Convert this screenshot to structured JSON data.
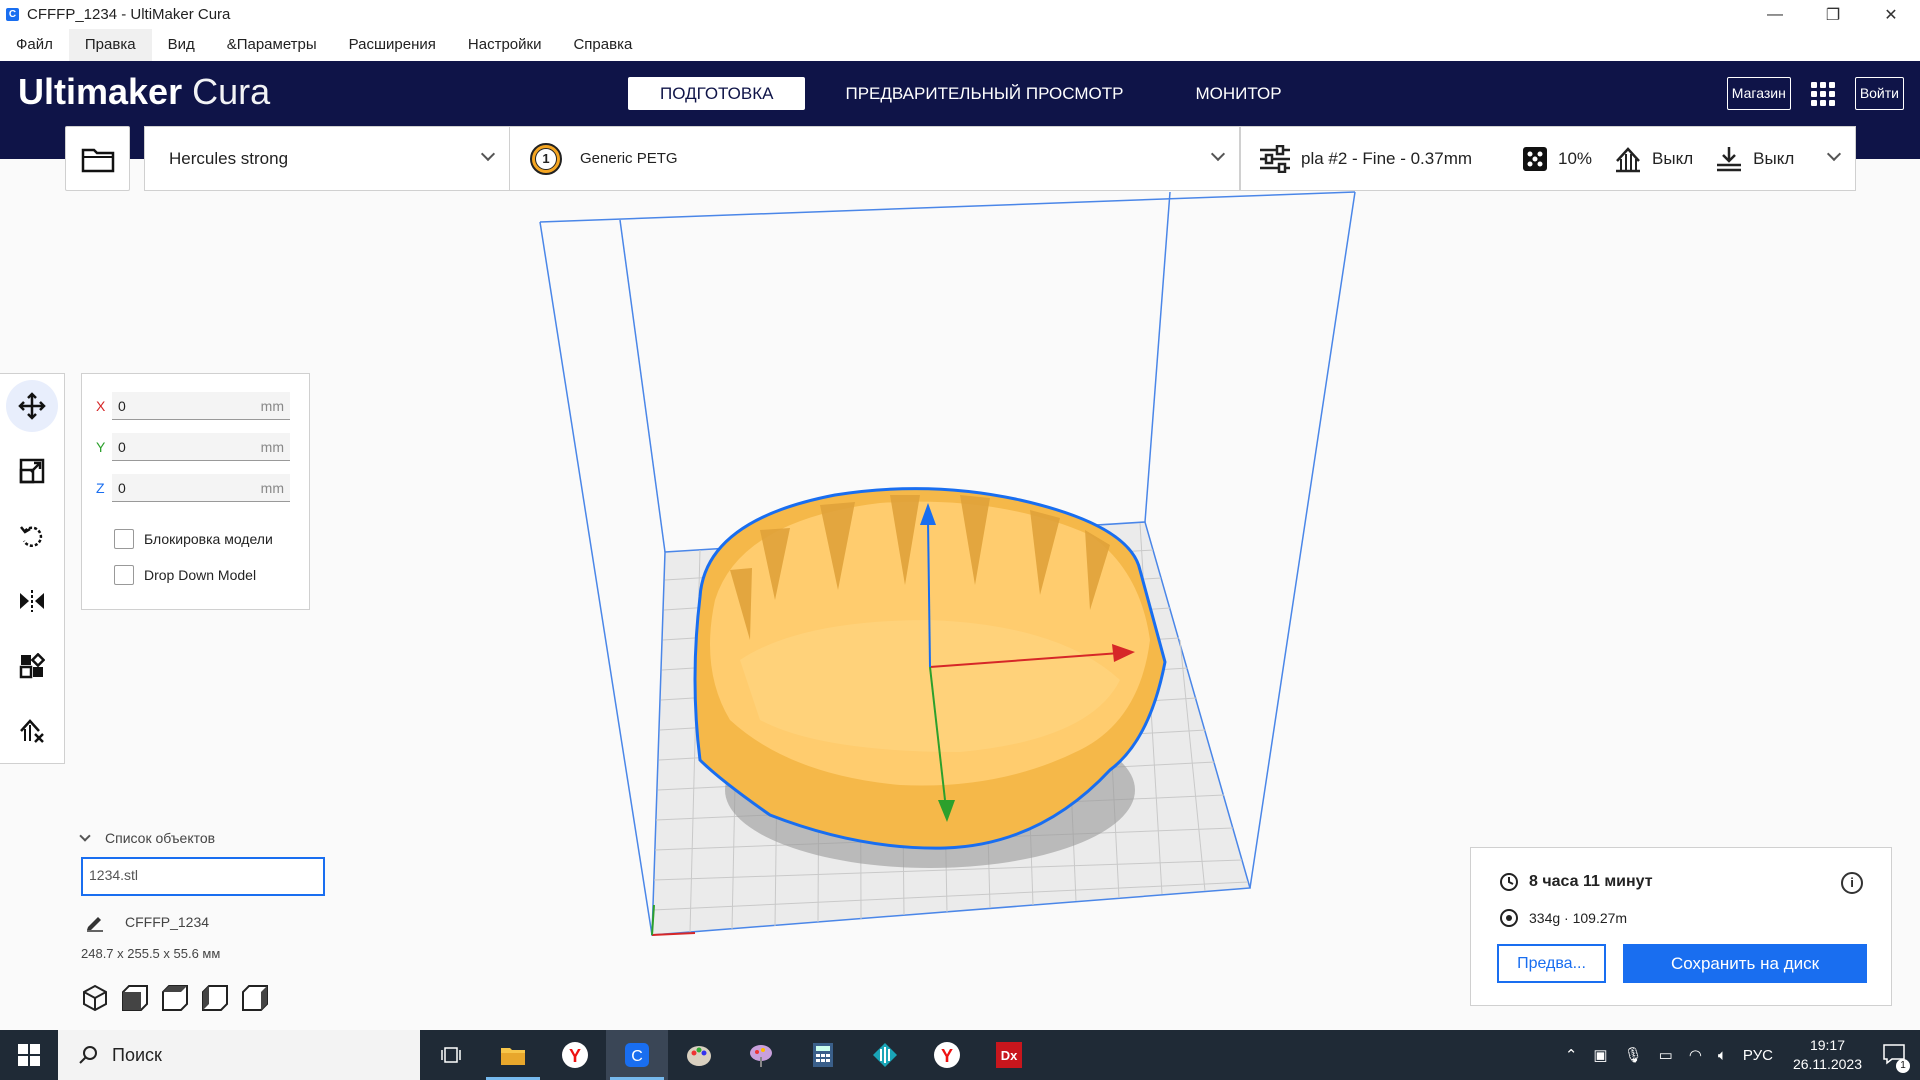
{
  "window": {
    "title": "CFFFP_1234 - UltiMaker Cura",
    "app_icon": "C"
  },
  "menu": [
    "Файл",
    "Правка",
    "Вид",
    "&Параметры",
    "Расширения",
    "Настройки",
    "Справка"
  ],
  "header": {
    "logo_bold": "Ultimaker",
    "logo_light": " Cura",
    "tabs": [
      "ПОДГОТОВКА",
      "ПРЕДВАРИТЕЛЬНЫЙ ПРОСМОТР",
      "МОНИТОР"
    ],
    "marketplace_label": "Магазин",
    "signin_label": "Войти"
  },
  "toolbar": {
    "printer": "Hercules strong",
    "extruder_number": "1",
    "material": "Generic PETG",
    "profile": "pla #2 - Fine - 0.37mm",
    "infill": "10%",
    "support": "Выкл",
    "adhesion": "Выкл"
  },
  "move_panel": {
    "x_label": "X",
    "x_value": "0",
    "y_label": "Y",
    "y_value": "0",
    "z_label": "Z",
    "z_value": "0",
    "unit": "mm",
    "lock_model": "Блокировка модели",
    "drop_down": "Drop Down Model"
  },
  "objects": {
    "header": "Список объектов",
    "file": "1234.stl",
    "job_name": "CFFFP_1234",
    "dimensions": "248.7 x 255.5 x 55.6 мм"
  },
  "job": {
    "time": "8 часа 11 минут",
    "material_usage": "334g · 109.27m",
    "preview_button": "Предва...",
    "save_button": "Сохранить на диск"
  },
  "taskbar": {
    "search_placeholder": "Поиск",
    "language": "РУС",
    "time": "19:17",
    "date": "26.11.2023",
    "notification_count": "1"
  },
  "colors": {
    "header": "#0f1448",
    "accent": "#196ef0",
    "model": "#ffc25a",
    "taskbar": "#1f2a36"
  }
}
